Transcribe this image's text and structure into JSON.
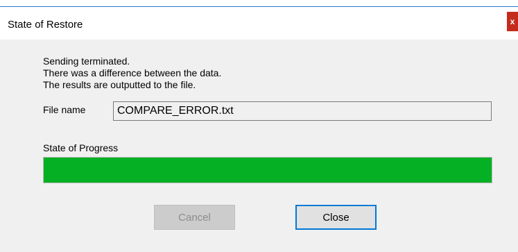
{
  "window": {
    "title": "State of Restore",
    "close_glyph": "x"
  },
  "message": {
    "line1": "Sending terminated.",
    "line2": "There was a difference between the data.",
    "line3": "The results are outputted to the file."
  },
  "file": {
    "label": "File name",
    "value": "COMPARE_ERROR.txt"
  },
  "progress": {
    "label": "State of Progress",
    "percent": 100,
    "fill_color": "#06b025"
  },
  "buttons": {
    "cancel_label": "Cancel",
    "cancel_enabled": false,
    "close_label": "Close"
  },
  "colors": {
    "accent": "#0078d7",
    "close_button": "#c42b1c"
  }
}
